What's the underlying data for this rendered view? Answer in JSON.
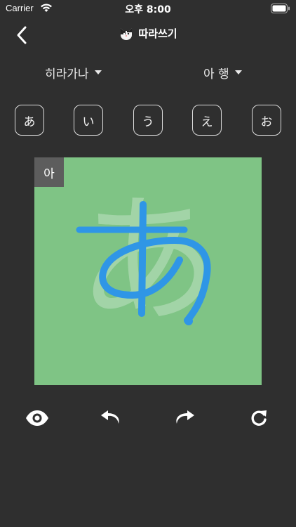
{
  "status_bar": {
    "carrier": "Carrier",
    "time": "오후 8:00"
  },
  "nav": {
    "title": "따라쓰기",
    "back_icon": "chevron-left-icon",
    "app_icon": "cat-face-icon"
  },
  "selectors": {
    "script": "히라가나",
    "row": "아 행"
  },
  "kana_buttons": [
    "あ",
    "い",
    "う",
    "え",
    "お"
  ],
  "canvas": {
    "label": "아",
    "guide_character": "あ",
    "background_color": "#7fc485",
    "stroke_color": "#2f96e6"
  },
  "toolbar": {
    "icons": [
      "eye-icon",
      "undo-icon",
      "redo-icon",
      "refresh-icon"
    ]
  }
}
